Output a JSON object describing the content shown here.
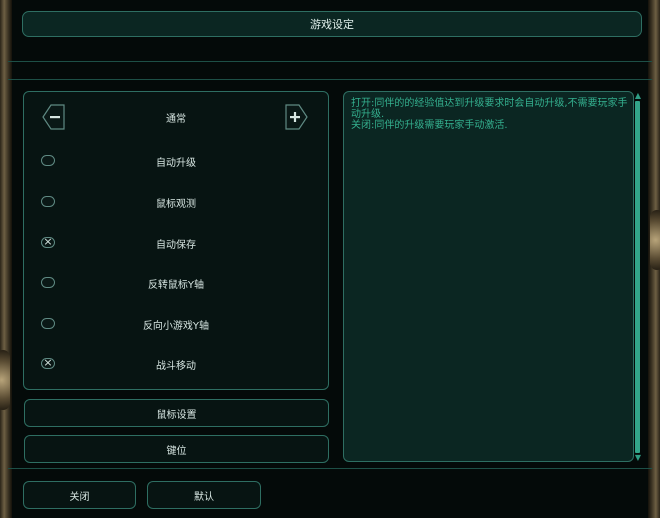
{
  "window": {
    "title": "游戏设定"
  },
  "panel": {
    "category": "通常",
    "prev_icon": "minus-arrow-icon",
    "next_icon": "plus-arrow-icon",
    "options": [
      {
        "label": "自动升级",
        "checked": false
      },
      {
        "label": "鼠标观测",
        "checked": false
      },
      {
        "label": "自动保存",
        "checked": true
      },
      {
        "label": "反转鼠标Y轴",
        "checked": false
      },
      {
        "label": "反向小游戏Y轴",
        "checked": false
      },
      {
        "label": "战斗移动",
        "checked": true
      }
    ]
  },
  "buttons": {
    "mouse_settings": "鼠标设置",
    "keybinds": "键位",
    "close": "关闭",
    "default": "默认"
  },
  "description": {
    "line1": "打开:同伴的的经验值达到升级要求时会自动升级,不需要玩家手动升级.",
    "line2": "关闭:同伴的升级需要玩家手动激活."
  },
  "colors": {
    "accent": "#2e6e62",
    "text_green": "#34b08f",
    "panel_bg": "#0b2622"
  }
}
